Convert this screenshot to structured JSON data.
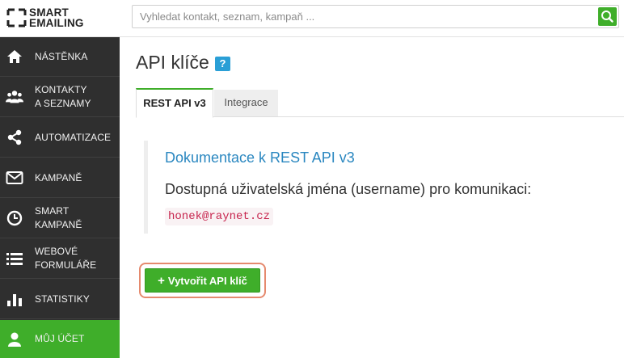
{
  "brand": {
    "line1": "SMART",
    "line2": "EMAILING"
  },
  "search": {
    "placeholder": "Vyhledat kontakt, seznam, kampaň ...",
    "value": ""
  },
  "sidebar": {
    "items": [
      {
        "label": "NÁSTĚNKA",
        "icon": "home-icon"
      },
      {
        "label": "KONTAKTY\nA SEZNAMY",
        "icon": "users-icon"
      },
      {
        "label": "AUTOMATIZACE",
        "icon": "share-icon"
      },
      {
        "label": "KAMPANĚ",
        "icon": "envelope-icon"
      },
      {
        "label": "SMART\nKAMPANĚ",
        "icon": "clock-icon"
      },
      {
        "label": "WEBOVÉ\nFORMULÁŘE",
        "icon": "list-icon"
      },
      {
        "label": "STATISTIKY",
        "icon": "bar-chart-icon"
      },
      {
        "label": "MŮJ ÚČET",
        "icon": "user-icon",
        "active": true
      }
    ]
  },
  "main": {
    "title": "API klíče",
    "help_badge": "?",
    "tabs": [
      {
        "label": "REST API v3",
        "active": true
      },
      {
        "label": "Integrace",
        "active": false
      }
    ],
    "doc_link": "Dokumentace k REST API v3",
    "usernames_text": "Dostupná uživatelská jména (username) pro komunikaci:",
    "username": "honek@raynet.cz",
    "create_button": "Vytvořit API klíč"
  },
  "colors": {
    "accent": "#3fae2a",
    "sidebar": "#2f2f2f",
    "link": "#2a87c0",
    "highlight": "#e58a6e"
  }
}
